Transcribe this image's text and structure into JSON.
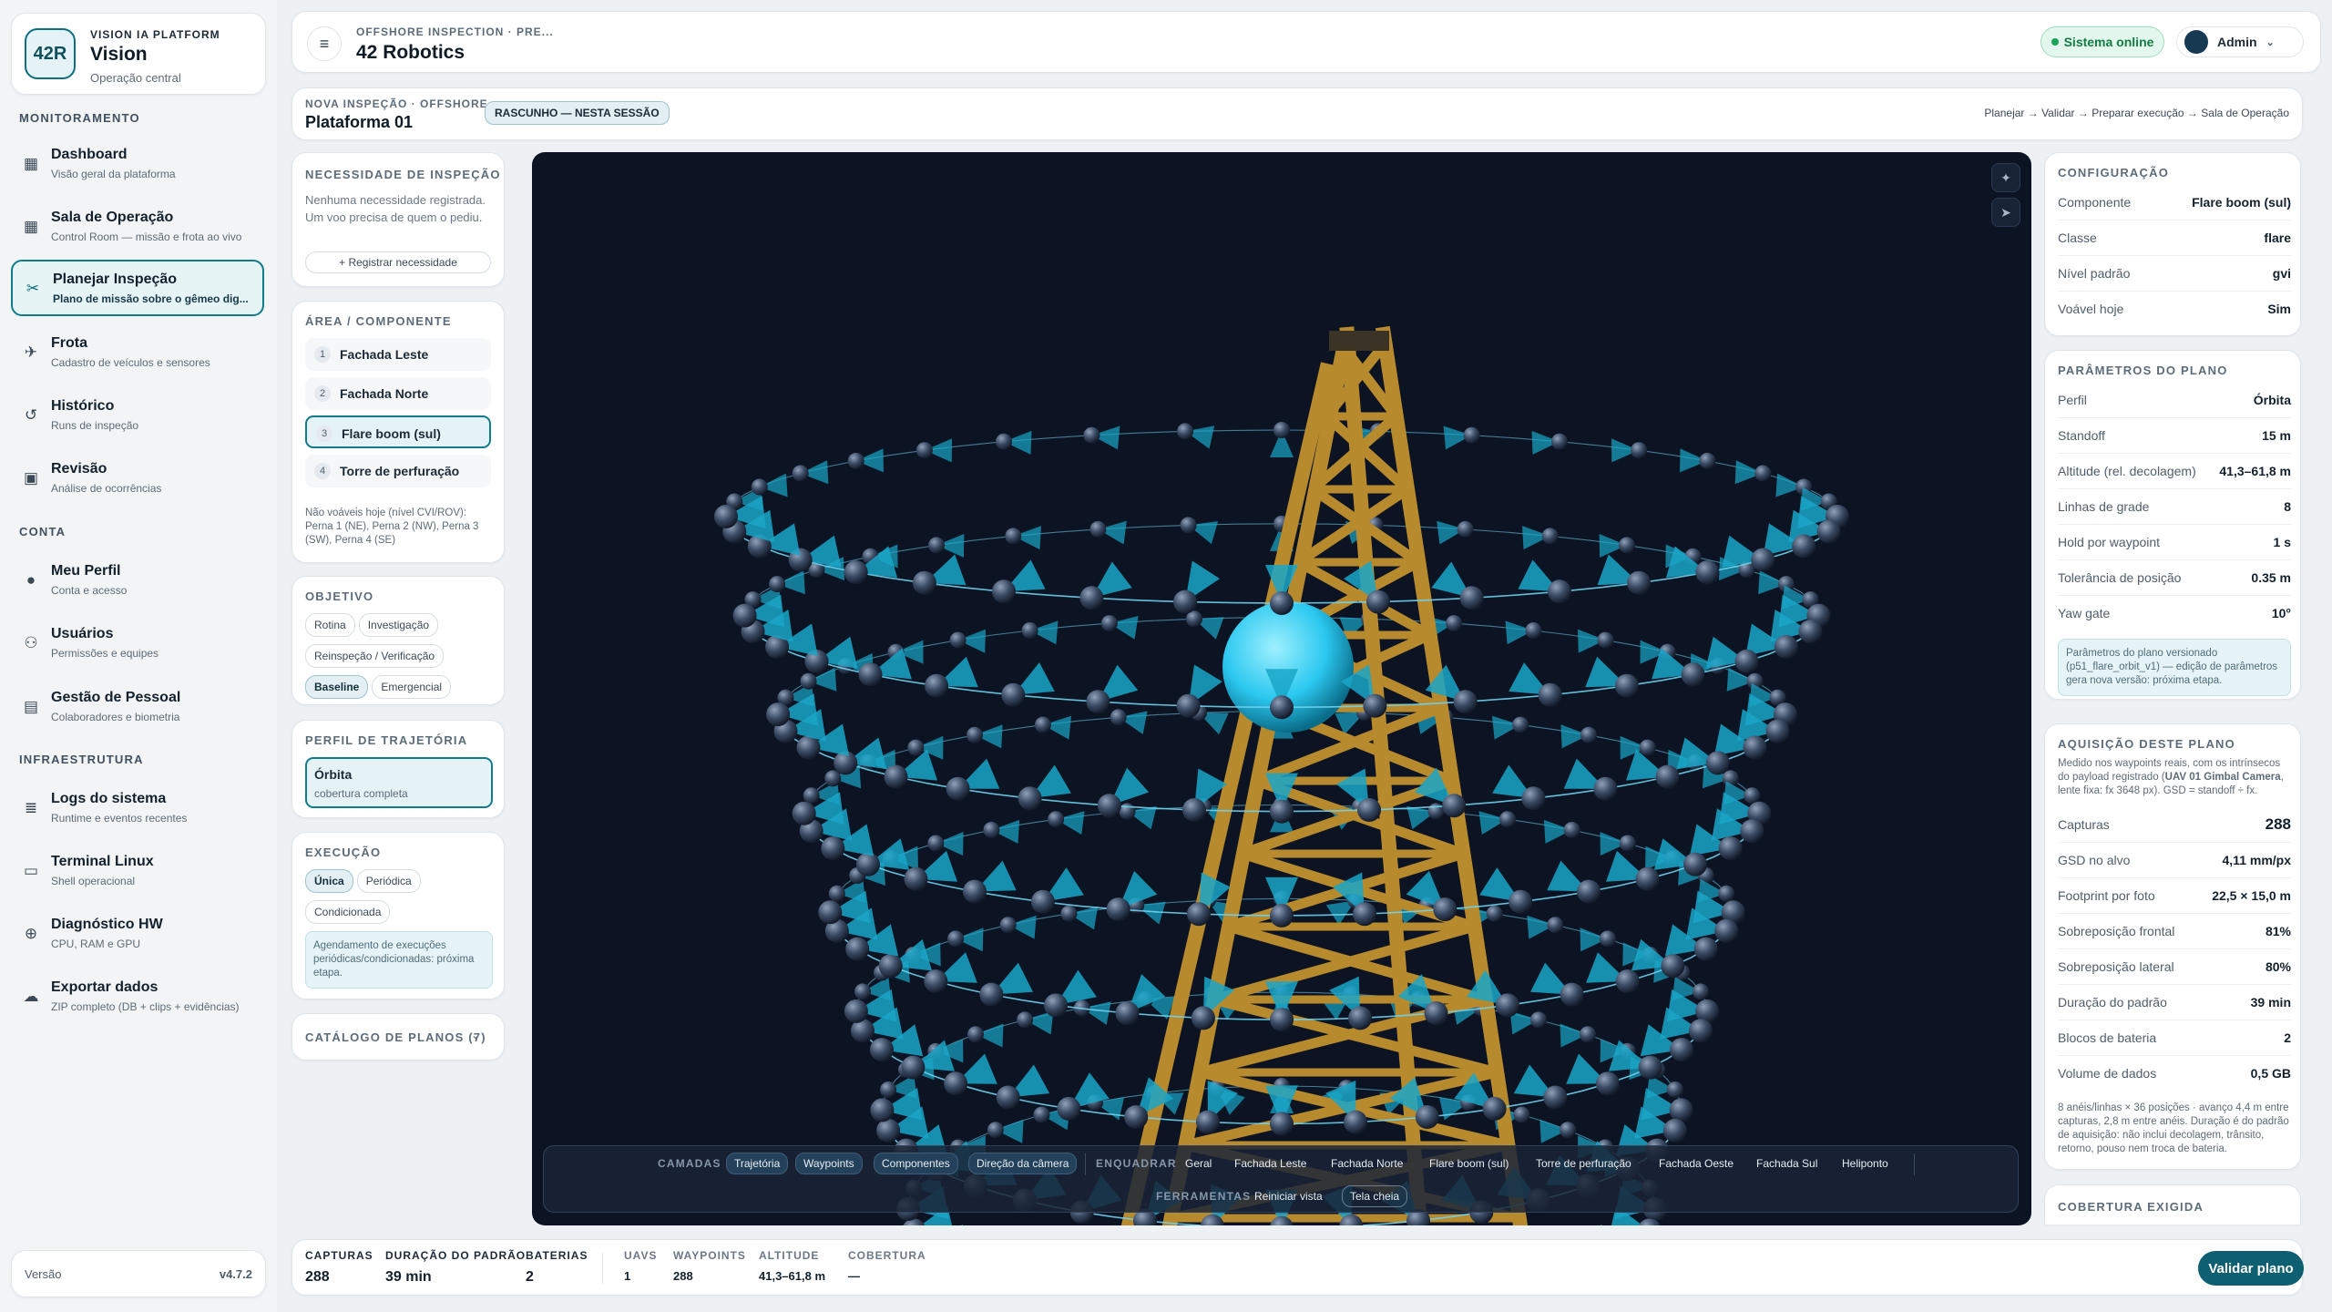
{
  "brand": {
    "platform": "VISION IA PLATFORM",
    "name": "Vision",
    "subtitle": "Operação central",
    "logo_text": "42R"
  },
  "sidebar": {
    "sections": [
      "MONITORAMENTO",
      "CONTA",
      "INFRAESTRUTURA"
    ],
    "items": [
      {
        "label": "Dashboard",
        "sub": "Visão geral da plataforma",
        "icon": "grid-icon"
      },
      {
        "label": "Sala de Operação",
        "sub": "Control Room — missão e frota ao vivo",
        "icon": "grid-icon"
      },
      {
        "label": "Planejar Inspeção",
        "sub": "Plano de missão sobre o gêmeo dig...",
        "icon": "tools-icon"
      },
      {
        "label": "Frota",
        "sub": "Cadastro de veículos e sensores",
        "icon": "plane-icon"
      },
      {
        "label": "Histórico",
        "sub": "Runs de inspeção",
        "icon": "history-icon"
      },
      {
        "label": "Revisão",
        "sub": "Análise de ocorrências",
        "icon": "review-icon"
      },
      {
        "label": "Meu Perfil",
        "sub": "Conta e acesso",
        "icon": "user-icon"
      },
      {
        "label": "Usuários",
        "sub": "Permissões e equipes",
        "icon": "users-icon"
      },
      {
        "label": "Gestão de Pessoal",
        "sub": "Colaboradores e biometria",
        "icon": "badge-icon"
      },
      {
        "label": "Logs do sistema",
        "sub": "Runtime e eventos recentes",
        "icon": "log-icon"
      },
      {
        "label": "Terminal Linux",
        "sub": "Shell operacional",
        "icon": "terminal-icon"
      },
      {
        "label": "Diagnóstico HW",
        "sub": "CPU, RAM e GPU",
        "icon": "chip-icon"
      },
      {
        "label": "Exportar dados",
        "sub": "ZIP completo (DB + clips + evidências)",
        "icon": "cloud-icon"
      }
    ],
    "version_label": "Versão",
    "version": "v4.7.2"
  },
  "topbar": {
    "breadcrumb": "OFFSHORE INSPECTION · PRE...",
    "title": "42 Robotics",
    "status": "Sistema online",
    "user": "Admin"
  },
  "subbar": {
    "kicker": "NOVA INSPEÇÃO · OFFSHORE",
    "title": "Plataforma 01",
    "badge": "RASCUNHO — NESTA SESSÃO",
    "steps": "Planejar → Validar → Preparar execução → Sala de Operação"
  },
  "need": {
    "title": "NECESSIDADE DE INSPEÇÃO",
    "text": "Nenhuma necessidade registrada. Um voo precisa de quem o pediu.",
    "button": "+ Registrar necessidade"
  },
  "areas": {
    "title": "ÁREA / COMPONENTE",
    "items": [
      {
        "n": "1",
        "label": "Fachada Leste"
      },
      {
        "n": "2",
        "label": "Fachada Norte"
      },
      {
        "n": "3",
        "label": "Flare boom (sul)"
      },
      {
        "n": "4",
        "label": "Torre de perfuração"
      }
    ],
    "note": "Não voáveis hoje (nível CVI/ROV): Perna 1 (NE), Perna 2 (NW), Perna 3 (SW), Perna 4 (SE)"
  },
  "objective": {
    "title": "OBJETIVO",
    "options": [
      "Rotina",
      "Investigação",
      "Reinspeção / Verificação",
      "Baseline",
      "Emergencial"
    ],
    "selected": "Baseline"
  },
  "trajectory": {
    "title": "PERFIL DE TRAJETÓRIA",
    "name": "Órbita",
    "sub": "cobertura completa"
  },
  "execution": {
    "title": "EXECUÇÃO",
    "options": [
      "Única",
      "Periódica",
      "Condicionada"
    ],
    "selected": "Única",
    "note": "Agendamento de execuções periódicas/condicionadas: próxima etapa."
  },
  "catalog": {
    "label": "CATÁLOGO DE PLANOS (7)"
  },
  "viewer": {
    "layers_label": "CAMADAS",
    "layers": [
      "Trajetória",
      "Waypoints",
      "Componentes",
      "Direção da câmera"
    ],
    "frame_label": "ENQUADRAR",
    "frames": [
      "Geral",
      "Fachada Leste",
      "Fachada Norte",
      "Flare boom (sul)",
      "Torre de perfuração",
      "Fachada Oeste",
      "Fachada Sul",
      "Heliponto"
    ],
    "tools_label": "FERRAMENTAS",
    "tools": [
      "Reiniciar vista",
      "Tela cheia"
    ],
    "rings": 8,
    "positions": 36,
    "colors": {
      "bg": "#0c1322",
      "tower": "#b88a2e",
      "cone": "#1aa6c8",
      "sphere": "#2a3850",
      "path": "#6fd3f0",
      "target": "#2bc8f0"
    }
  },
  "config": {
    "title": "CONFIGURAÇÃO",
    "rows": [
      {
        "k": "Componente",
        "v": "Flare boom (sul)"
      },
      {
        "k": "Classe",
        "v": "flare"
      },
      {
        "k": "Nível padrão",
        "v": "gvi"
      },
      {
        "k": "Voável hoje",
        "v": "Sim"
      }
    ]
  },
  "params": {
    "title": "PARÂMETROS DO PLANO",
    "rows": [
      {
        "k": "Perfil",
        "v": "Órbita"
      },
      {
        "k": "Standoff",
        "v": "15 m"
      },
      {
        "k": "Altitude (rel. decolagem)",
        "v": "41,3–61,8 m"
      },
      {
        "k": "Linhas de grade",
        "v": "8"
      },
      {
        "k": "Hold por waypoint",
        "v": "1 s"
      },
      {
        "k": "Tolerância de posição",
        "v": "0.35 m"
      },
      {
        "k": "Yaw gate",
        "v": "10°"
      }
    ],
    "note": "Parâmetros do plano versionado (p51_flare_orbit_v1) — edição de parâmetros gera nova versão: próxima etapa."
  },
  "acquisition": {
    "title": "AQUISIÇÃO DESTE PLANO",
    "intro_a": "Medido nos waypoints reais, com os intrínsecos do payload registrado (",
    "intro_b": "UAV 01 Gimbal Camera",
    "intro_c": ", lente fixa: fx 3648 px). GSD = standoff ÷ fx.",
    "rows": [
      {
        "k": "Capturas",
        "v": "288"
      },
      {
        "k": "GSD no alvo",
        "v": "4,11 mm/px"
      },
      {
        "k": "Footprint por foto",
        "v": "22,5 × 15,0 m"
      },
      {
        "k": "Sobreposição frontal",
        "v": "81%"
      },
      {
        "k": "Sobreposição lateral",
        "v": "80%"
      },
      {
        "k": "Duração do padrão",
        "v": "39 min"
      },
      {
        "k": "Blocos de bateria",
        "v": "2"
      },
      {
        "k": "Volume de dados",
        "v": "0,5 GB"
      }
    ],
    "foot": "8 anéis/linhas × 36 posições · avanço 4,4 m entre capturas, 2,8 m entre anéis. Duração é do padrão de aquisição: não inclui decolagem, trânsito, retorno, pouso nem troca de bateria."
  },
  "coverage": {
    "title": "COBERTURA EXIGIDA"
  },
  "bottom": {
    "stats": [
      {
        "k": "CAPTURAS",
        "v": "288"
      },
      {
        "k": "DURAÇÃO DO PADRÃO",
        "v": "39 min"
      },
      {
        "k": "BATERIAS",
        "v": "2"
      }
    ],
    "extra": [
      {
        "k": "UAVS",
        "v": "1"
      },
      {
        "k": "WAYPOINTS",
        "v": "288"
      },
      {
        "k": "ALTITUDE",
        "v": "41,3–61,8 m"
      },
      {
        "k": "COBERTURA",
        "v": "—"
      }
    ],
    "validate": "Validar plano"
  }
}
